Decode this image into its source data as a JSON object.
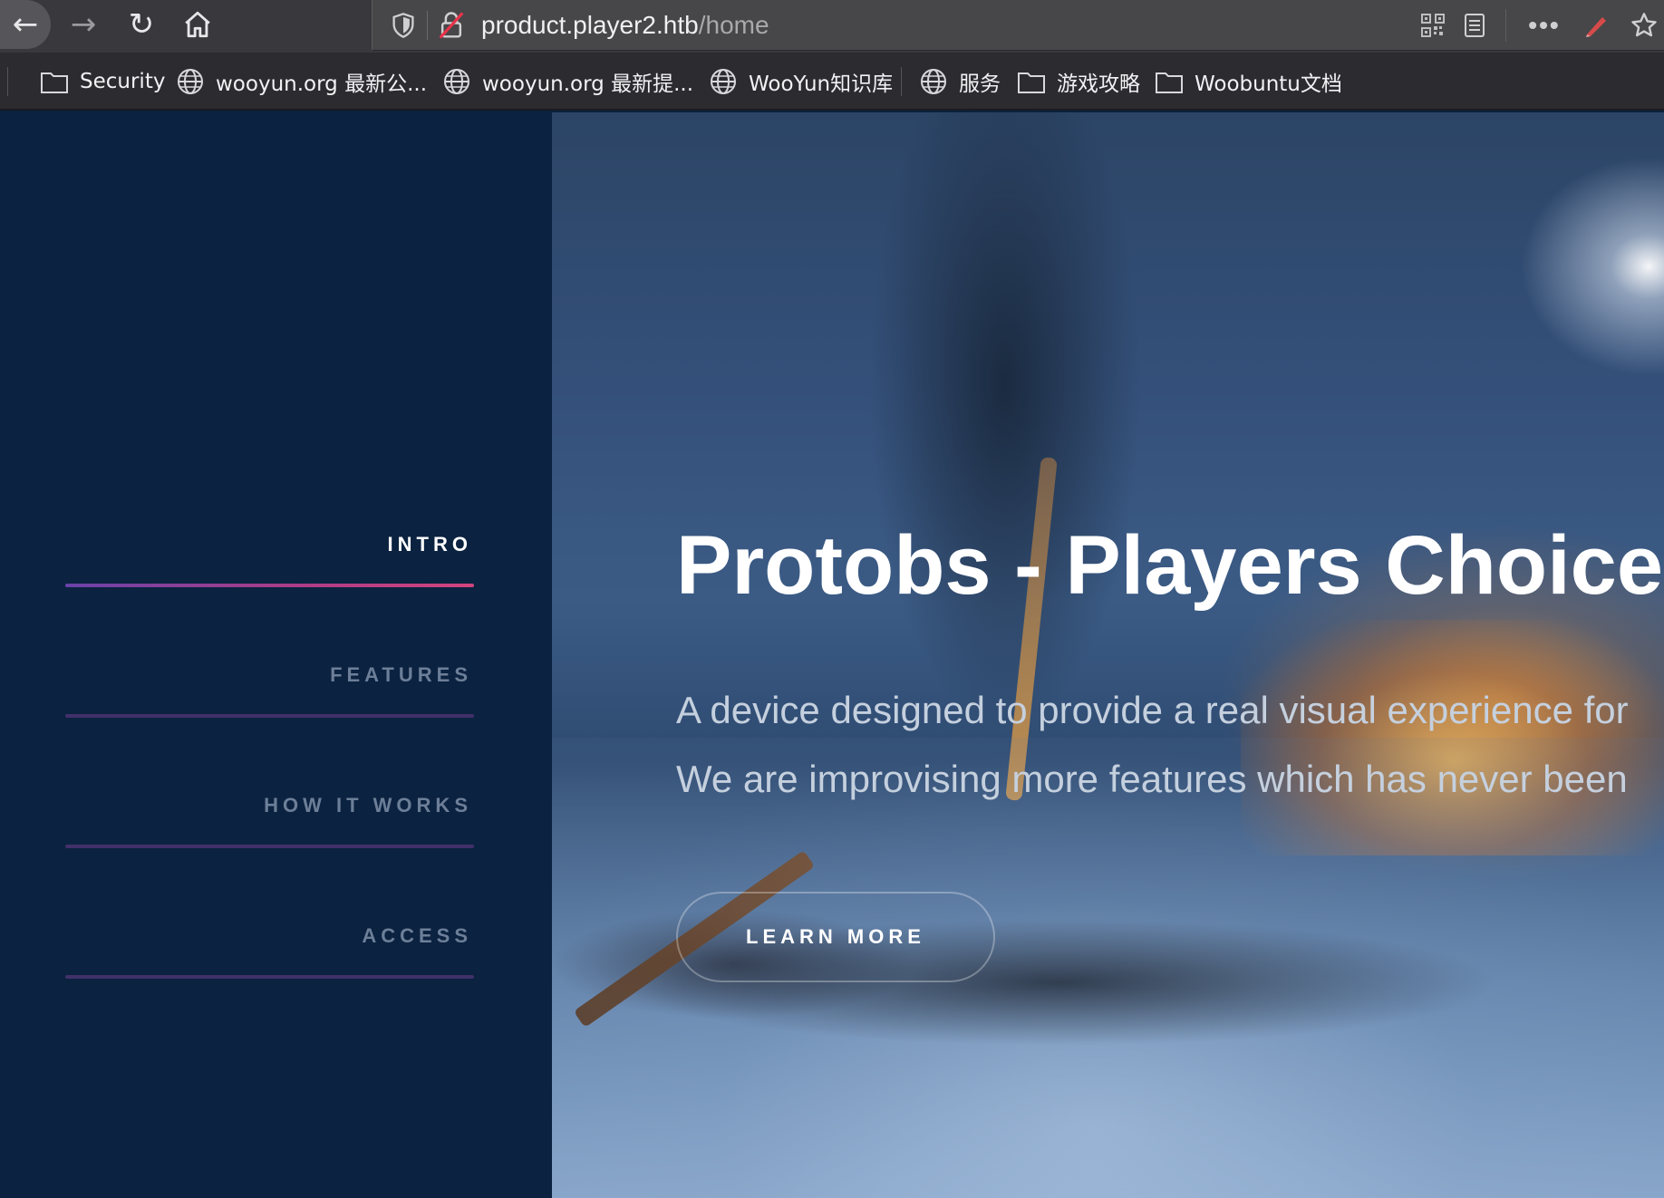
{
  "browser": {
    "url_scheme_hidden": true,
    "url_host": "product.player2.htb",
    "url_path": "/home",
    "bookmarks": [
      {
        "label": "Security",
        "icon": "folder-icon"
      },
      {
        "label": "wooyun.org 最新公...",
        "icon": "globe-icon"
      },
      {
        "label": "wooyun.org 最新提...",
        "icon": "globe-icon"
      },
      {
        "label": "WooYun知识库",
        "icon": "globe-icon"
      },
      {
        "label": "服务",
        "icon": "globe-icon"
      },
      {
        "label": "游戏攻略",
        "icon": "folder-icon"
      },
      {
        "label": "Woobuntu文档",
        "icon": "folder-icon"
      }
    ]
  },
  "sidebar": {
    "items": [
      {
        "label": "INTRO",
        "active": true
      },
      {
        "label": "FEATURES",
        "active": false
      },
      {
        "label": "HOW IT WORKS",
        "active": false
      },
      {
        "label": "ACCESS",
        "active": false
      }
    ]
  },
  "hero": {
    "title": "Protobs - Players Choice",
    "subtitle_line1": "A device designed to provide a real visual experience for",
    "subtitle_line2": "We are improvising more features which has never been",
    "cta_label": "LEARN MORE"
  },
  "colors": {
    "sidebar_bg": "#0b2240",
    "active_underline_start": "#6a42a8",
    "active_underline_end": "#d2447e",
    "inactive_underline": "#41306a",
    "toolbar_bg": "#38383d",
    "bookmarks_bg": "#2b2b30"
  }
}
